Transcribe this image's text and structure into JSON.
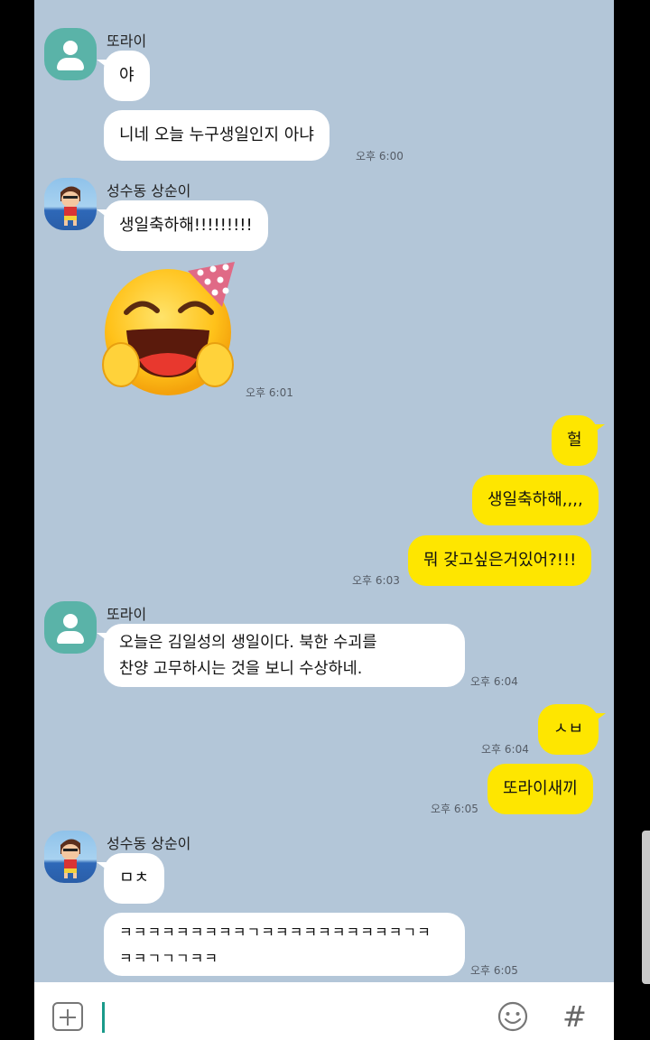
{
  "messages": [
    {
      "sender": "또라이",
      "text": "야"
    },
    {
      "text": "니네 오늘 누구생일인지 아냐",
      "time": "오후 6:00"
    },
    {
      "sender": "성수동 상순이",
      "text": "생일축하해!!!!!!!!!"
    },
    {
      "sticker": "party-hat-laughing-emoticon",
      "time": "오후 6:01"
    },
    {
      "text": "헐"
    },
    {
      "text": "생일축하해,,,,"
    },
    {
      "text": "뭐 갖고싶은거있어?!!!",
      "time": "오후 6:03"
    },
    {
      "sender": "또라이",
      "line1": "오늘은 김일성의 생일이다. 북한 수괴를",
      "line2": "찬양 고무하시는 것을 보니 수상하네.",
      "time": "오후 6:04"
    },
    {
      "text": "ㅅㅂ",
      "time": "오후 6:04"
    },
    {
      "text": "또라이새끼",
      "time": "오후 6:05"
    },
    {
      "sender": "성수동 상순이",
      "text": "ㅁㅊ"
    },
    {
      "line1": "ㅋㅋㅋㅋㅋㅋㅋㅋㅋㄱㅋㅋㅋㅋㅋㅋㅋㅋㅋㅋㄱㅋ",
      "line2": "ㅋㅋㄱㄱㄱㅋㅋ",
      "time": "오후 6:05"
    }
  ],
  "input_bar": {
    "placeholder": "",
    "plus_icon": "plus-square-icon",
    "emoji_icon": "smiley-icon",
    "hash_label": "#"
  },
  "colors": {
    "background": "#b3c6d8",
    "my_bubble": "#fee600",
    "their_bubble": "#ffffff",
    "default_avatar": "#5ab3a8"
  }
}
